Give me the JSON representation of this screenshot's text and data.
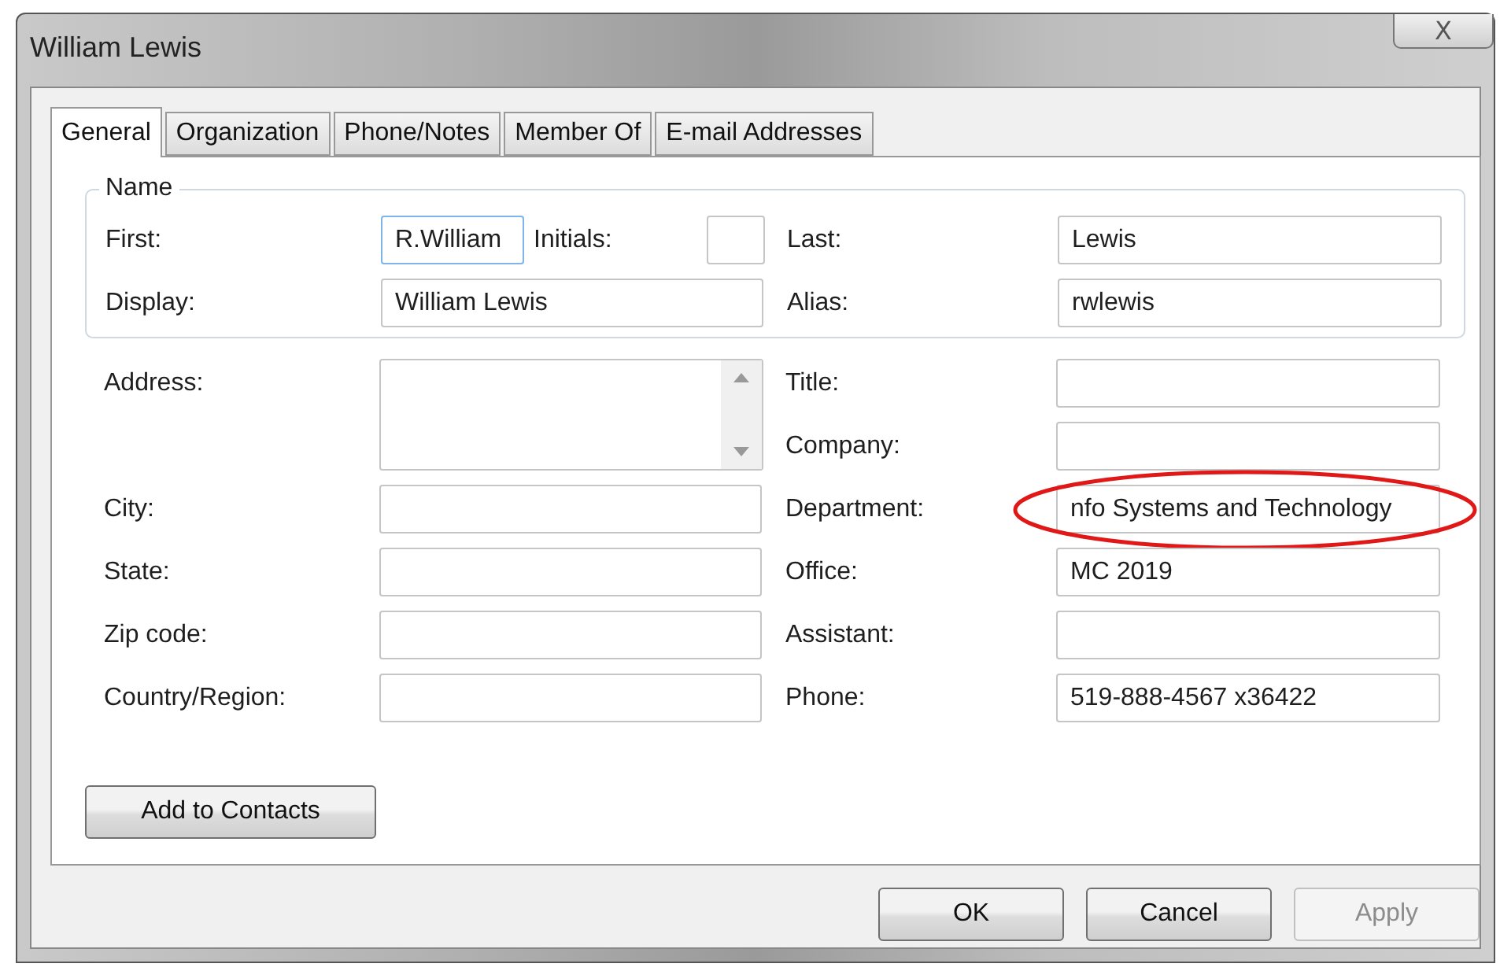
{
  "window": {
    "title": "William Lewis",
    "close_glyph": "X"
  },
  "tabs": [
    {
      "label": "General",
      "selected": true
    },
    {
      "label": "Organization",
      "selected": false
    },
    {
      "label": "Phone/Notes",
      "selected": false
    },
    {
      "label": "Member Of",
      "selected": false
    },
    {
      "label": "E-mail Addresses",
      "selected": false
    }
  ],
  "name_group": {
    "legend": "Name",
    "first": {
      "label": "First:",
      "value": "R.William",
      "focused": true
    },
    "initials": {
      "label": "Initials:"
    },
    "last": {
      "label": "Last:",
      "value": "Lewis"
    },
    "display": {
      "label": "Display:",
      "value": "William Lewis"
    },
    "alias": {
      "label": "Alias:",
      "value": "rwlewis"
    }
  },
  "left_fields": [
    {
      "label": "Address:",
      "kind": "multiline"
    },
    {
      "label": "City:",
      "kind": "text"
    },
    {
      "label": "State:",
      "kind": "text"
    },
    {
      "label": "Zip code:",
      "kind": "text"
    },
    {
      "label": "Country/Region:",
      "kind": "text"
    }
  ],
  "right_fields": [
    {
      "label": "Title:",
      "circled": false
    },
    {
      "label": "Company:",
      "circled": false
    },
    {
      "label": "Department:",
      "value": "nfo Systems and Technology",
      "circled": true
    },
    {
      "label": "Office:",
      "value": "MC 2019",
      "circled": false
    },
    {
      "label": "Assistant:",
      "circled": false
    },
    {
      "label": "Phone:",
      "value": "519-888-4567 x36422",
      "circled": false
    }
  ],
  "add_button": "Add to Contacts",
  "buttons": [
    {
      "label": "OK",
      "disabled": false
    },
    {
      "label": "Cancel",
      "disabled": false
    },
    {
      "label": "Apply",
      "disabled": true
    }
  ]
}
